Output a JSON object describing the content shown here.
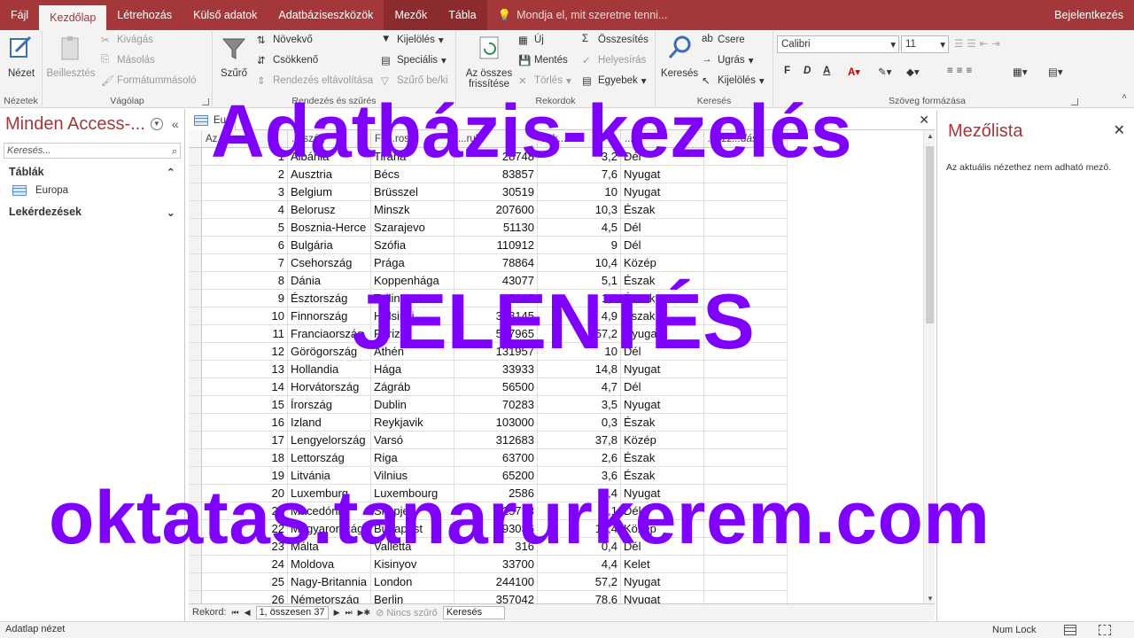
{
  "tabs": {
    "items": [
      "Fájl",
      "Kezdőlap",
      "Létrehozás",
      "Külső adatok",
      "Adatbáziseszközök",
      "Mezők",
      "Tábla"
    ],
    "tell_me": "Mondja el, mit szeretne tenni...",
    "signin": "Bejelentkezés"
  },
  "ribbon": {
    "views": {
      "button": "Nézet",
      "group": "Nézetek"
    },
    "clipboard": {
      "paste": "Beillesztés",
      "cut": "Kivágás",
      "copy": "Másolás",
      "format_painter": "Formátummásoló",
      "group": "Vágólap"
    },
    "sort_filter": {
      "filter": "Szűrő",
      "ascending": "Növekvő",
      "descending": "Csökkenő",
      "remove_sort": "Rendezés eltávolítása",
      "selection": "Kijelölés",
      "advanced": "Speciális",
      "toggle_filter": "Szűrő be/ki",
      "group": "Rendezés és szűrés"
    },
    "records": {
      "refresh_all_1": "Az összes",
      "refresh_all_2": "frissítése",
      "new": "Új",
      "save": "Mentés",
      "delete": "Törlés",
      "totals": "Összesítés",
      "spelling": "Helyesírás",
      "more": "Egyebek",
      "group": "Rekordok"
    },
    "find": {
      "find": "Keresés",
      "replace": "Csere",
      "goto": "Ugrás",
      "select": "Kijelölés",
      "group": "Keresés"
    },
    "text_format": {
      "font": "Calibri",
      "size": "11",
      "bold": "F",
      "italic": "D",
      "underline": "A",
      "group": "Szöveg formázása"
    }
  },
  "navpane": {
    "title": "Minden Access-...",
    "search_placeholder": "Keresés...",
    "group_tables": "Táblák",
    "table_item": "Europa",
    "group_queries": "Lekérdezések"
  },
  "document": {
    "tab_title": "Eu"
  },
  "grid": {
    "headers": [
      "Azonosító",
      "Ország",
      "Főváros",
      "Terület",
      "Lakosság",
      "Régió",
      "Kattintson a hozzáadáshoz"
    ],
    "visible_headers": [
      "Az...ó",
      "...rszág",
      "Fő...ros",
      "...rule",
      "Lak...",
      "...aj",
      "...ozz...dás"
    ],
    "rows": [
      [
        "1",
        "Albánia",
        "Tirana",
        "28748",
        "3,2",
        "Dél"
      ],
      [
        "2",
        "Ausztria",
        "Bécs",
        "83857",
        "7,6",
        "Nyugat"
      ],
      [
        "3",
        "Belgium",
        "Brüsszel",
        "30519",
        "10",
        "Nyugat"
      ],
      [
        "4",
        "Belorusz",
        "Minszk",
        "207600",
        "10,3",
        "Észak"
      ],
      [
        "5",
        "Bosznia-Herce",
        "Szarajevo",
        "51130",
        "4,5",
        "Dél"
      ],
      [
        "6",
        "Bulgária",
        "Szófia",
        "110912",
        "9",
        "Dél"
      ],
      [
        "7",
        "Csehország",
        "Prága",
        "78864",
        "10,4",
        "Közép"
      ],
      [
        "8",
        "Dánia",
        "Koppenhága",
        "43077",
        "5,1",
        "Észak"
      ],
      [
        "9",
        "Észtország",
        "Tallinn",
        "45215",
        "1,6",
        "Észak"
      ],
      [
        "10",
        "Finnország",
        "Helsinki",
        "338145",
        "4,9",
        "Észak"
      ],
      [
        "11",
        "Franciaország",
        "Párizs",
        "547965",
        "57,2",
        "Nyugat"
      ],
      [
        "12",
        "Görögország",
        "Athén",
        "131957",
        "10",
        "Dél"
      ],
      [
        "13",
        "Hollandia",
        "Hága",
        "33933",
        "14,8",
        "Nyugat"
      ],
      [
        "14",
        "Horvátország",
        "Zágráb",
        "56500",
        "4,7",
        "Dél"
      ],
      [
        "15",
        "Írország",
        "Dublin",
        "70283",
        "3,5",
        "Nyugat"
      ],
      [
        "16",
        "Izland",
        "Reykjavik",
        "103000",
        "0,3",
        "Észak"
      ],
      [
        "17",
        "Lengyelország",
        "Varsó",
        "312683",
        "37,8",
        "Közép"
      ],
      [
        "18",
        "Lettország",
        "Riga",
        "63700",
        "2,6",
        "Észak"
      ],
      [
        "19",
        "Litvánia",
        "Vilnius",
        "65200",
        "3,6",
        "Észak"
      ],
      [
        "20",
        "Luxemburg",
        "Luxembourg",
        "2586",
        "0,4",
        "Nyugat"
      ],
      [
        "21",
        "Macedónia",
        "Skopje",
        "25713",
        "2,1",
        "Dél"
      ],
      [
        "22",
        "Magyarország",
        "Budapest",
        "93036",
        "10,4",
        "Közép"
      ],
      [
        "23",
        "Málta",
        "Valletta",
        "316",
        "0,4",
        "Dél"
      ],
      [
        "24",
        "Moldova",
        "Kisinyov",
        "33700",
        "4,4",
        "Kelet"
      ],
      [
        "25",
        "Nagy-Britannia",
        "London",
        "244100",
        "57,2",
        "Nyugat"
      ],
      [
        "26",
        "Németország",
        "Berlin",
        "357042",
        "78,6",
        "Nyugat"
      ]
    ]
  },
  "recordbar": {
    "label": "Rekord:",
    "position": "1, összesen 37",
    "filter": "Nincs szűrő",
    "search": "Keresés"
  },
  "fieldlist": {
    "title": "Mezőlista",
    "message": "Az aktuális nézethez nem adható mező."
  },
  "status": {
    "view": "Adatlap nézet",
    "numlock": "Num Lock"
  },
  "overlay": {
    "line1": "Adatbázis-kezelés",
    "line2": "JELENTÉS",
    "line3": "oktatas.tanarurkerem.com"
  },
  "colors": {
    "accent": "#a4373a",
    "overlay": "#8000ff"
  }
}
